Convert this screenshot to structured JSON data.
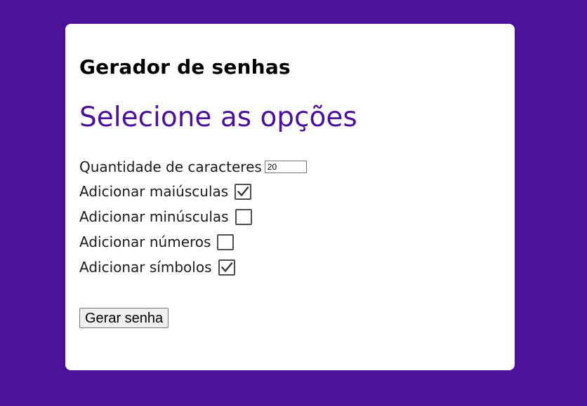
{
  "colors": {
    "page_background": "#4c1199",
    "card_background": "#ffffff",
    "accent": "#4c1199"
  },
  "header": {
    "title": "Gerador de senhas"
  },
  "options": {
    "heading": "Selecione as opções",
    "length": {
      "label": "Quantidade de caracteres",
      "value": "20"
    },
    "uppercase": {
      "label": "Adicionar maiúsculas",
      "checked": true
    },
    "lowercase": {
      "label": "Adicionar minúsculas",
      "checked": false
    },
    "numbers": {
      "label": "Adicionar números",
      "checked": false
    },
    "symbols": {
      "label": "Adicionar símbolos",
      "checked": true
    }
  },
  "actions": {
    "generate_label": "Gerar senha"
  }
}
